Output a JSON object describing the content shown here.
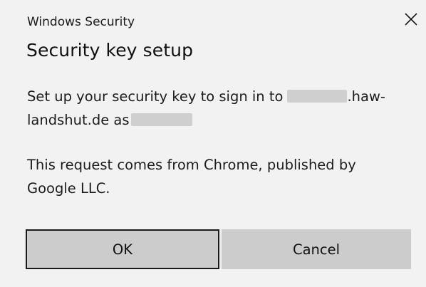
{
  "window": {
    "app_title": "Windows Security",
    "close_icon": "close-icon"
  },
  "dialog": {
    "heading": "Security key setup",
    "message_prefix": "Set up your security key to sign in to",
    "message_domain_suffix": ".haw-",
    "message_line2_prefix": "landshut.de as",
    "request_info": "This request comes from Chrome, published by Google LLC."
  },
  "buttons": {
    "ok_label": "OK",
    "cancel_label": "Cancel"
  },
  "colors": {
    "background": "#f2f2f2",
    "button_fill": "#cccccc",
    "focus_border": "#1a1a1a",
    "redaction": "#cfcfcf"
  }
}
